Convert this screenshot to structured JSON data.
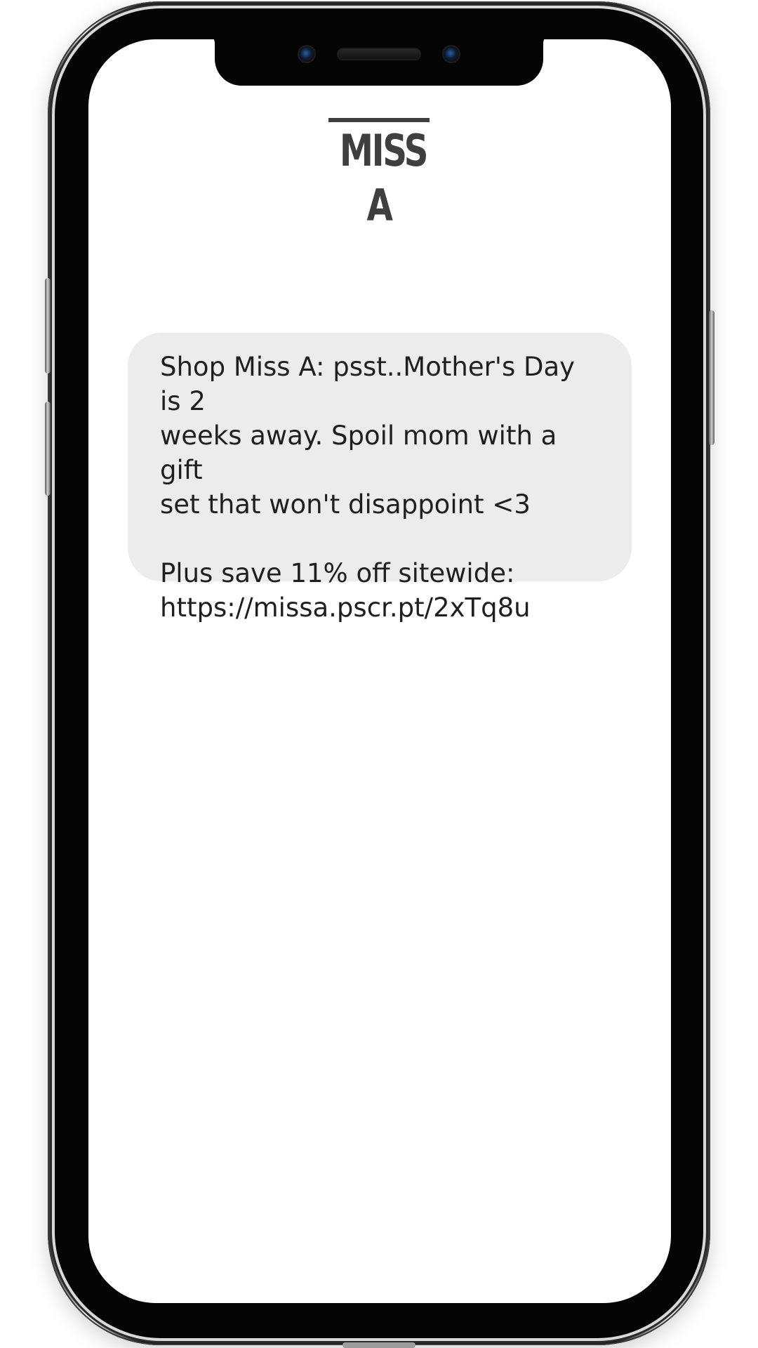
{
  "brand": {
    "logo_text": "MISS A"
  },
  "message": {
    "body": "Shop Miss A: psst..Mother's Day is 2\nweeks away. Spoil mom with a gift\nset that won't disappoint <3\n\nPlus save 11% off sitewide:\nhttps://missa.pscr.pt/2xTq8u"
  },
  "colors": {
    "bubble_background": "#ececec",
    "message_text": "#1f1f1f",
    "logo": "#3f3f3f",
    "phone_frame": "#050505"
  },
  "icons": {
    "camera_left": "camera-icon",
    "camera_right": "sensor-icon",
    "speaker": "speaker-grille-icon"
  }
}
